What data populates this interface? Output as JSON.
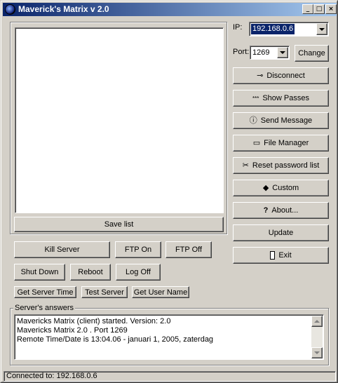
{
  "window": {
    "title": "Maverick's Matrix v 2.0",
    "controls": {
      "minimize": "_",
      "maximize": "□",
      "close": "×"
    }
  },
  "connection": {
    "ip_label": "IP:",
    "ip_value": "192.168.0.6",
    "port_label": "Port:",
    "port_value": "1269",
    "change_label": "Change"
  },
  "side_buttons": [
    {
      "label": "Disconnect",
      "icon": "plug-icon"
    },
    {
      "label": "Show Passes",
      "icon": "passwords-icon"
    },
    {
      "label": "Send Message",
      "icon": "message-icon"
    },
    {
      "label": "File Manager",
      "icon": "folder-icon"
    },
    {
      "label": "Reset password list",
      "icon": "scissors-icon"
    },
    {
      "label": "Custom",
      "icon": "diamond-icon"
    },
    {
      "label": "About...",
      "icon": "question-icon"
    },
    {
      "label": "Update",
      "icon": ""
    },
    {
      "label": "Exit",
      "icon": "door-icon"
    }
  ],
  "list": {
    "save_label": "Save list"
  },
  "actions": {
    "kill_server": "Kill Server",
    "ftp_on": "FTP On",
    "ftp_off": "FTP Off",
    "shut_down": "Shut Down",
    "reboot": "Reboot",
    "log_off": "Log Off",
    "get_server_time": "Get Server Time",
    "test_server": "Test Server",
    "get_user_name": "Get User Name"
  },
  "answers": {
    "label": "Server's answers",
    "lines": [
      "Mavericks Matrix (client) started. Version: 2.0",
      "Mavericks Matrix 2.0 . Port 1269",
      "Remote Time/Date is 13:04.06 - januari 1, 2005, zaterdag"
    ]
  },
  "status": {
    "text": "Connected to: 192.168.0.6"
  },
  "colors": {
    "face": "#d4d0c8",
    "title_start": "#0a246a",
    "title_end": "#a6caf0",
    "selection": "#0a246a"
  }
}
